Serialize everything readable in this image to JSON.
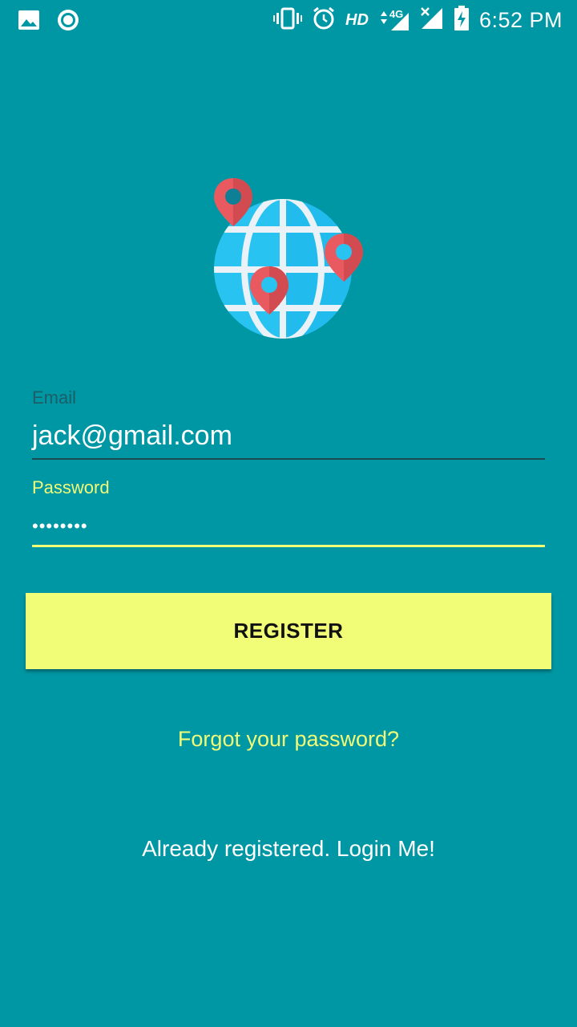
{
  "status_bar": {
    "time": "6:52 PM",
    "hd": "HD",
    "network": "4G",
    "left_icons": [
      "image-icon",
      "record-icon"
    ],
    "right_icons": [
      "vibrate-icon",
      "alarm-icon",
      "hd-icon",
      "signal-4g-icon",
      "signal-no-sim-icon",
      "battery-charging-icon"
    ]
  },
  "logo": {
    "icon": "globe-with-location-pins-icon"
  },
  "form": {
    "email_label": "Email",
    "email_value": "jack@gmail.com",
    "password_label": "Password",
    "password_value": "••••••••"
  },
  "actions": {
    "register_label": "REGISTER",
    "forgot_label": "Forgot your password?",
    "login_label": "Already registered. Login Me!"
  },
  "colors": {
    "background": "#0097A4",
    "accent": "#F1FC77",
    "email_label": "#1C5E67",
    "globe": "#29C3F2",
    "pin": "#E85A5F"
  }
}
